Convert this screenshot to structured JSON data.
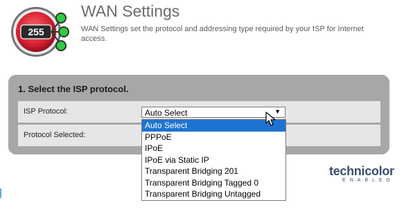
{
  "header": {
    "logo_number": "255",
    "title": "WAN Settings",
    "description": "WAN Settings set the protocol and addressing type required by your ISP for Internet access."
  },
  "section": {
    "title": "1. Select the ISP protocol.",
    "rows": [
      {
        "label": "ISP Protocol:"
      },
      {
        "label": "Protocol Selected:"
      }
    ]
  },
  "isp_select": {
    "value": "Auto Select",
    "arrow": "▼",
    "options": [
      "Auto Select",
      "PPPoE",
      "IPoE",
      "IPoE via Static IP",
      "Transparent Bridging 201",
      "Transparent Bridging Tagged 0",
      "Transparent Bridging Untagged"
    ],
    "highlighted_option": "Auto Select"
  },
  "branding": {
    "name": "technicolor",
    "tagline": "ENABLED"
  },
  "colors": {
    "highlight": "#1e73d2",
    "panel": "#a7a7a7",
    "row": "#e6e6e6",
    "logo_red": "#d8202f",
    "logo_green": "#2ecc40"
  },
  "icons": {
    "logo": "globe-badge-icon",
    "cursor": "mouse-pointer-icon",
    "dropdown_arrow": "caret-down-icon"
  }
}
